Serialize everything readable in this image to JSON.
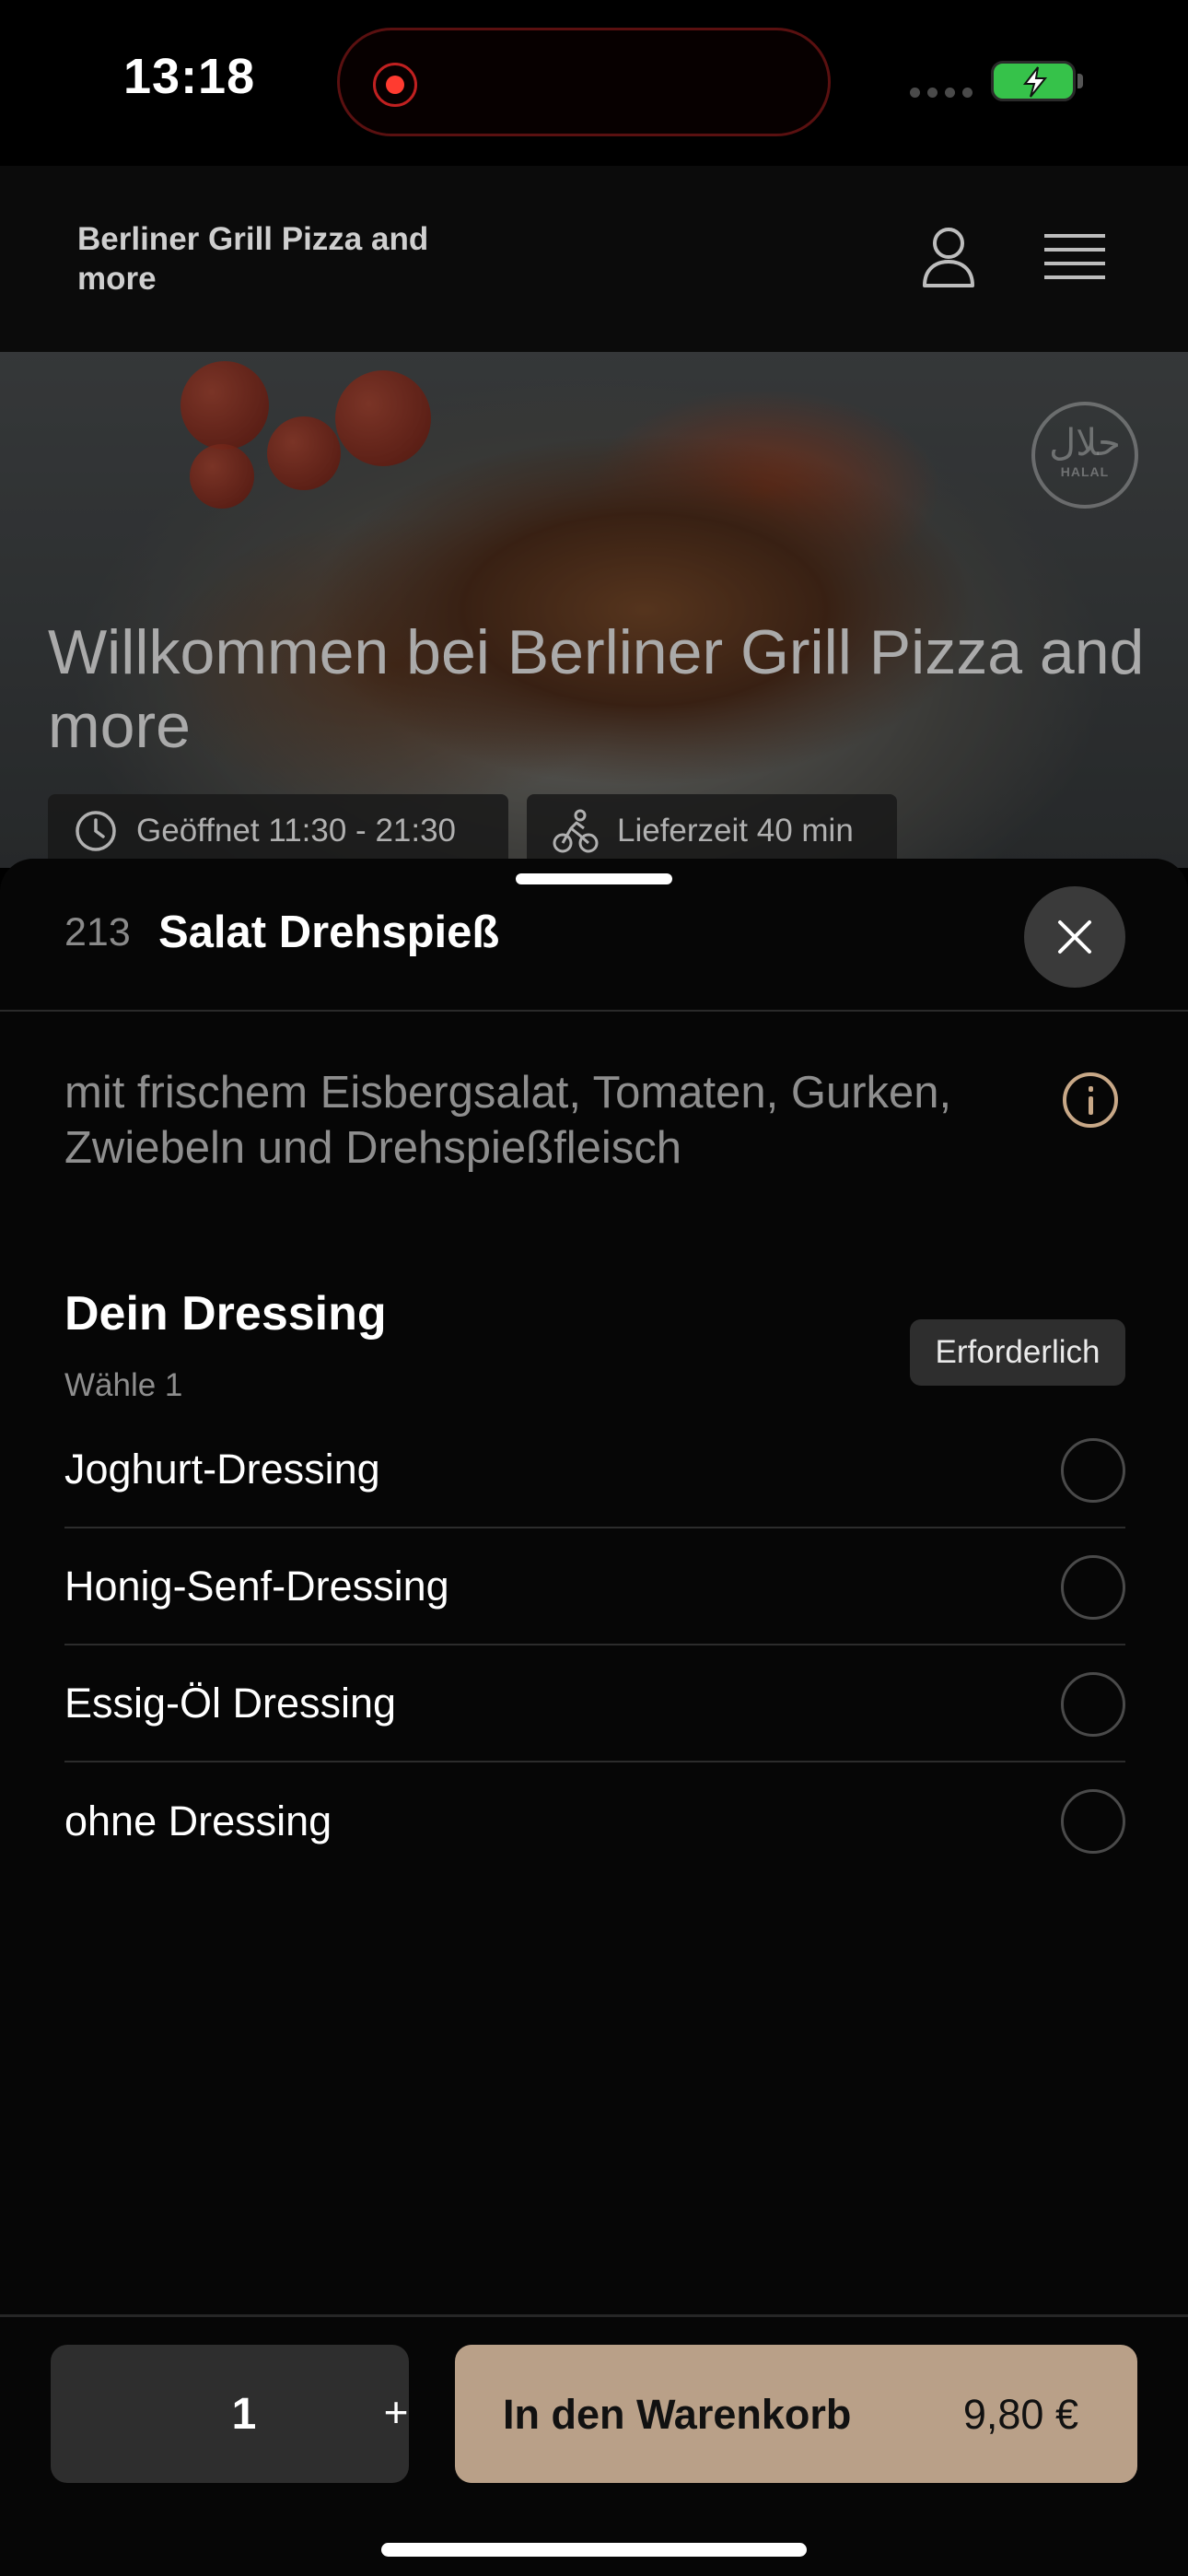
{
  "status_bar": {
    "time": "13:18"
  },
  "header": {
    "restaurant_name": "Berliner Grill Pizza and more",
    "icons": [
      "user-icon",
      "menu-icon"
    ]
  },
  "hero": {
    "title": "Willkommen bei Berliner Grill Pizza and more",
    "badge_arabic": "حلال",
    "badge_text": "HALAL",
    "opening_hours": "Geöffnet 11:30 - 21:30",
    "delivery_time": "Lieferzeit 40 min"
  },
  "product": {
    "number": "213",
    "name": "Salat Drehspieß",
    "description": "mit frischem Eisbergsalat, Tomaten, Gurken, Zwiebeln und Drehspießfleisch"
  },
  "dressing_section": {
    "title": "Dein Dressing",
    "subtitle": "Wähle 1",
    "badge": "Erforderlich",
    "options": [
      {
        "label": "Joghurt-Dressing"
      },
      {
        "label": "Honig-Senf-Dressing"
      },
      {
        "label": "Essig-Öl Dressing"
      },
      {
        "label": "ohne Dressing"
      }
    ]
  },
  "cart": {
    "quantity": "1",
    "plus_label": "+",
    "add_label": "In den Warenkorb",
    "price": "9,80 €"
  },
  "colors": {
    "accent": "#b9a088",
    "info_icon": "#c8a887",
    "background": "#060606",
    "battery": "#36c24a",
    "recording": "#ff3b30"
  }
}
